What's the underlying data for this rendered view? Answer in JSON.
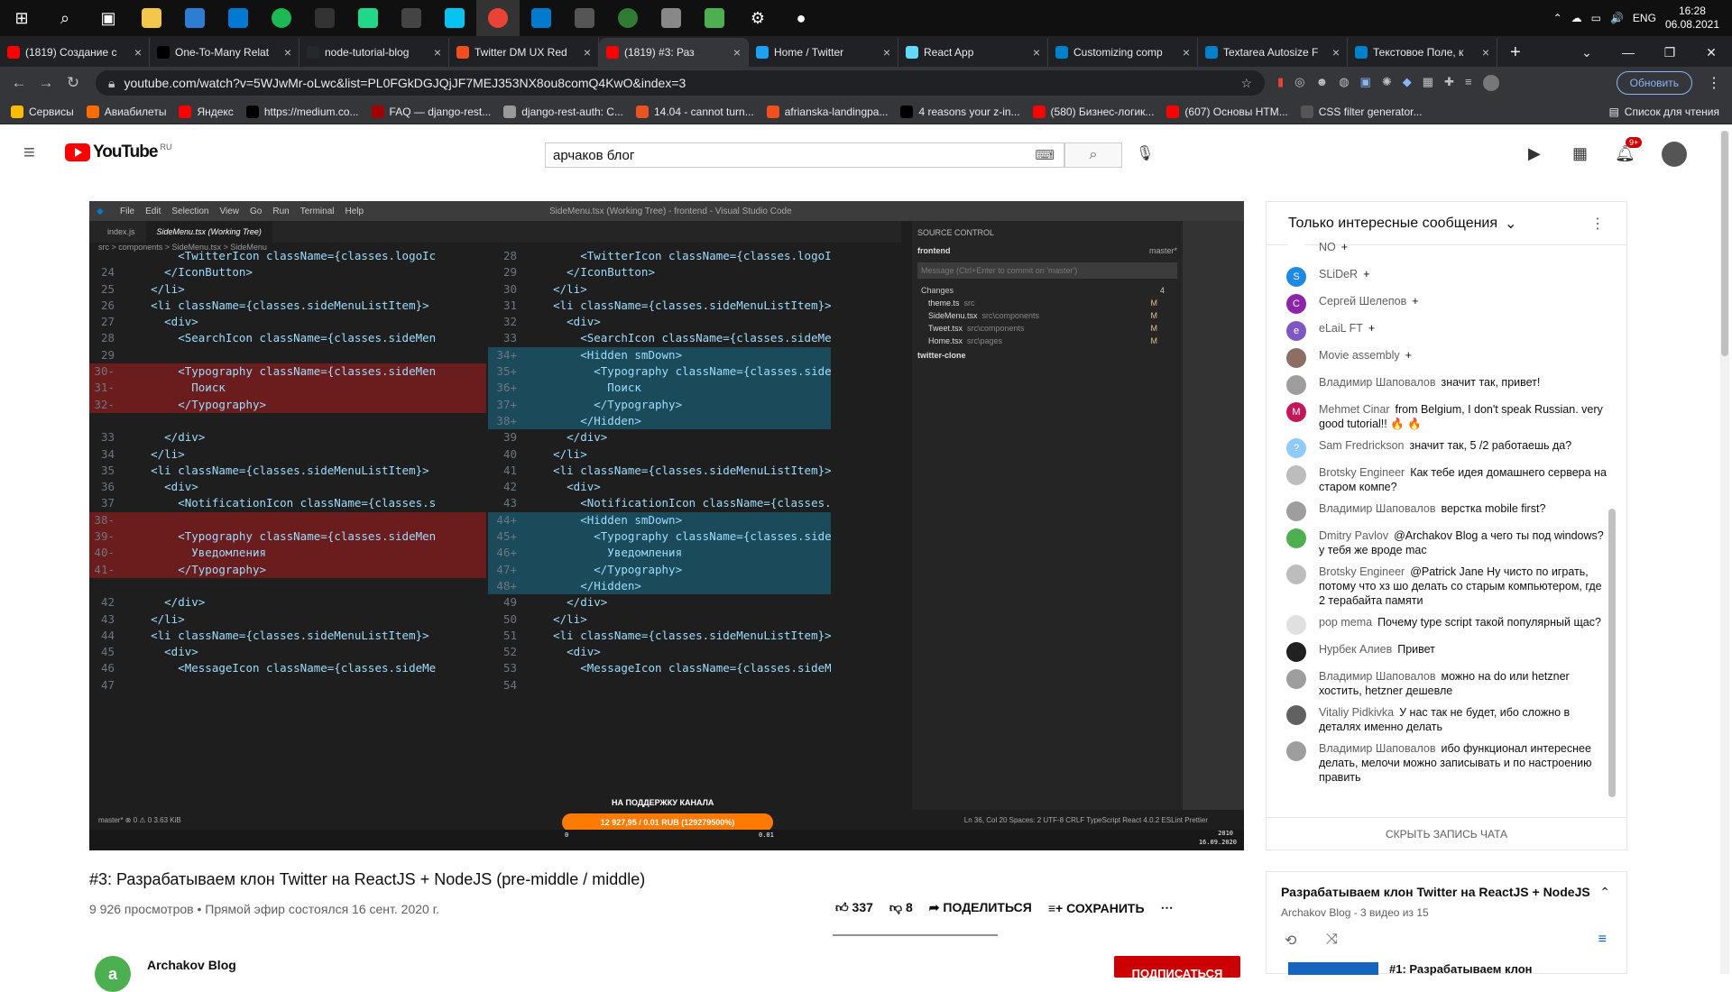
{
  "taskbar": {
    "clock_time": "16:28",
    "clock_date": "06.08.2021",
    "lang": "ENG"
  },
  "tabs": [
    {
      "title": "(1819) Создание с",
      "color": "#ff0000"
    },
    {
      "title": "One-To-Many Relat",
      "color": "#000000"
    },
    {
      "title": "node-tutorial-blog",
      "color": "#24292e"
    },
    {
      "title": "Twitter DM UX Red",
      "color": "#f24e1e"
    },
    {
      "title": "(1819) #3: Раз",
      "color": "#ff0000"
    },
    {
      "title": "Home / Twitter",
      "color": "#1da1f2"
    },
    {
      "title": "React App",
      "color": "#61dafb"
    },
    {
      "title": "Customizing comp",
      "color": "#0081cb"
    },
    {
      "title": "Textarea Autosize F",
      "color": "#0081cb"
    },
    {
      "title": "Текстовое Поле, к",
      "color": "#0081cb"
    }
  ],
  "address": {
    "url": "youtube.com/watch?v=5WJwMr-oLwc&list=PL0FGkDGJQjJF7MEJ353NX8ou8comQ4KwO&index=3",
    "update_label": "Обновить"
  },
  "bookmarks": [
    {
      "label": "Сервисы",
      "color": "#fbbc04"
    },
    {
      "label": "Авиабилеты",
      "color": "#ff6d00"
    },
    {
      "label": "Яндекс",
      "color": "#ff0000"
    },
    {
      "label": "https://medium.co...",
      "color": "#000000"
    },
    {
      "label": "FAQ — django-rest...",
      "color": "#a30000"
    },
    {
      "label": "django-rest-auth: C...",
      "color": "#999999"
    },
    {
      "label": "14.04 - cannot turn...",
      "color": "#e95420"
    },
    {
      "label": "afrianska-landingpa...",
      "color": "#f24e1e"
    },
    {
      "label": "4 reasons your z-in...",
      "color": "#000000"
    },
    {
      "label": "(580) Бизнес-логик...",
      "color": "#ff0000"
    },
    {
      "label": "(607) Основы HTM...",
      "color": "#ff0000"
    },
    {
      "label": "CSS filter generator...",
      "color": "#555555"
    }
  ],
  "bookmarks_reading_list": "Список для чтения",
  "youtube": {
    "logo_text": "YouTube",
    "region": "RU",
    "search_value": "арчаков блог",
    "notif_count": "9+"
  },
  "video_code": {
    "window_title": "SideMenu.tsx (Working Tree) - frontend - Visual Studio Code",
    "menu": [
      "File",
      "Edit",
      "Selection",
      "View",
      "Go",
      "Run",
      "Terminal",
      "Help"
    ],
    "tab1": "index.js",
    "tab2": "SideMenu.tsx (Working Tree)",
    "breadcrumb": "src > components > SideMenu.tsx > SideMenu",
    "left_lines": [
      {
        "n": "",
        "t": "        <TwitterIcon className={classes.logoIc",
        "bg": ""
      },
      {
        "n": "24",
        "t": "      </IconButton>",
        "bg": ""
      },
      {
        "n": "25",
        "t": "    </li>",
        "bg": ""
      },
      {
        "n": "26",
        "t": "    <li className={classes.sideMenuListItem}>",
        "bg": ""
      },
      {
        "n": "27",
        "t": "      <div>",
        "bg": ""
      },
      {
        "n": "28",
        "t": "        <SearchIcon className={classes.sideMen",
        "bg": ""
      },
      {
        "n": "29",
        "t": "",
        "bg": ""
      },
      {
        "n": "30-",
        "t": "        <Typography className={classes.sideMen",
        "bg": "#6b1c1c"
      },
      {
        "n": "31-",
        "t": "          Поиск",
        "bg": "#6b1c1c"
      },
      {
        "n": "32-",
        "t": "        </Typography>",
        "bg": "#6b1c1c"
      },
      {
        "n": "",
        "t": "",
        "bg": ""
      },
      {
        "n": "33",
        "t": "      </div>",
        "bg": ""
      },
      {
        "n": "34",
        "t": "    </li>",
        "bg": ""
      },
      {
        "n": "35",
        "t": "    <li className={classes.sideMenuListItem}>",
        "bg": ""
      },
      {
        "n": "36",
        "t": "      <div>",
        "bg": ""
      },
      {
        "n": "37",
        "t": "        <NotificationIcon className={classes.s",
        "bg": ""
      },
      {
        "n": "38-",
        "t": "",
        "bg": "#6b1c1c"
      },
      {
        "n": "39-",
        "t": "        <Typography className={classes.sideMen",
        "bg": "#6b1c1c"
      },
      {
        "n": "40-",
        "t": "          Уведомления",
        "bg": "#6b1c1c"
      },
      {
        "n": "41-",
        "t": "        </Typography>",
        "bg": "#6b1c1c"
      },
      {
        "n": "",
        "t": "",
        "bg": ""
      },
      {
        "n": "42",
        "t": "      </div>",
        "bg": ""
      },
      {
        "n": "43",
        "t": "    </li>",
        "bg": ""
      },
      {
        "n": "44",
        "t": "    <li className={classes.sideMenuListItem}>",
        "bg": ""
      },
      {
        "n": "45",
        "t": "      <div>",
        "bg": ""
      },
      {
        "n": "46",
        "t": "        <MessageIcon className={classes.sideMe",
        "bg": ""
      },
      {
        "n": "47",
        "t": "",
        "bg": ""
      }
    ],
    "right_lines": [
      {
        "n": "28",
        "t": "        <TwitterIcon className={classes.logoIc",
        "bg": ""
      },
      {
        "n": "29",
        "t": "      </IconButton>",
        "bg": ""
      },
      {
        "n": "30",
        "t": "    </li>",
        "bg": ""
      },
      {
        "n": "31",
        "t": "    <li className={classes.sideMenuListItem}>",
        "bg": ""
      },
      {
        "n": "32",
        "t": "      <div>",
        "bg": ""
      },
      {
        "n": "33",
        "t": "        <SearchIcon className={classes.sideMen",
        "bg": ""
      },
      {
        "n": "34+",
        "t": "        <Hidden smDown>",
        "bg": "#1b4b5a"
      },
      {
        "n": "35+",
        "t": "          <Typography className={classes.sideM",
        "bg": "#1b4b5a"
      },
      {
        "n": "36+",
        "t": "            Поиск",
        "bg": "#1b4b5a"
      },
      {
        "n": "37+",
        "t": "          </Typography>",
        "bg": "#1b4b5a"
      },
      {
        "n": "38+",
        "t": "        </Hidden>",
        "bg": "#1b4b5a"
      },
      {
        "n": "39",
        "t": "      </div>",
        "bg": ""
      },
      {
        "n": "40",
        "t": "    </li>",
        "bg": ""
      },
      {
        "n": "41",
        "t": "    <li className={classes.sideMenuListItem}>",
        "bg": ""
      },
      {
        "n": "42",
        "t": "      <div>",
        "bg": ""
      },
      {
        "n": "43",
        "t": "        <NotificationIcon className={classes.s",
        "bg": ""
      },
      {
        "n": "44+",
        "t": "        <Hidden smDown>",
        "bg": "#1b4b5a"
      },
      {
        "n": "45+",
        "t": "          <Typography className={classes.sideM",
        "bg": "#1b4b5a"
      },
      {
        "n": "46+",
        "t": "            Уведомления",
        "bg": "#1b4b5a"
      },
      {
        "n": "47+",
        "t": "          </Typography>",
        "bg": "#1b4b5a"
      },
      {
        "n": "48+",
        "t": "        </Hidden>",
        "bg": "#1b4b5a"
      },
      {
        "n": "49",
        "t": "      </div>",
        "bg": ""
      },
      {
        "n": "50",
        "t": "    </li>",
        "bg": ""
      },
      {
        "n": "51",
        "t": "    <li className={classes.sideMenuListItem}>",
        "bg": ""
      },
      {
        "n": "52",
        "t": "      <div>",
        "bg": ""
      },
      {
        "n": "53",
        "t": "        <MessageIcon className={classes.sideMe",
        "bg": ""
      },
      {
        "n": "54",
        "t": "",
        "bg": ""
      }
    ],
    "scm": {
      "title": "SOURCE CONTROL",
      "repo1": "frontend",
      "branch": "master*",
      "message_placeholder": "Message (Ctrl+Enter to commit on 'master')",
      "changes_label": "Changes",
      "changes_count": "4",
      "files": [
        {
          "name": "theme.ts",
          "path": "src",
          "status": "M"
        },
        {
          "name": "SideMenu.tsx",
          "path": "src\\components",
          "status": "M"
        },
        {
          "name": "Tweet.tsx",
          "path": "src\\components",
          "status": "M"
        },
        {
          "name": "Home.tsx",
          "path": "src\\pages",
          "status": "M"
        }
      ],
      "repo2": "twitter-clone"
    },
    "status_left": "master*   ⊗ 0 ⚠ 0   3.63 KiB",
    "status_right": "Ln 36, Col 20   Spaces: 2   UTF-8   CRLF   TypeScript React   4.0.2   ESLint   Prettier",
    "donation_title": "НА ПОДДЕРЖКУ КАНАЛА",
    "donation_amount": "12 927,95 / 0.01 RUB (129279500%)",
    "donation_min": "0",
    "donation_max": "0.01",
    "overlay_time": "2010",
    "overlay_date": "16.09.2020"
  },
  "video": {
    "title": "#3: Разрабатываем клон Twitter на ReactJS + NodeJS (pre-middle / middle)",
    "meta": "9 926 просмотров • Прямой эфир состоялся 16 сент. 2020 г.",
    "likes": "337",
    "dislikes": "8",
    "share": "ПОДЕЛИТЬСЯ",
    "save": "СОХРАНИТЬ",
    "channel": "Archakov Blog",
    "subscribe": "ПОДПИСАТЬСЯ"
  },
  "chat": {
    "header": "Только интересные сообщения",
    "hide": "СКРЫТЬ ЗАПИСЬ ЧАТА",
    "messages": [
      {
        "author": "NO",
        "text": "+",
        "avatar_letter": "",
        "avatar_color": "#ffffff"
      },
      {
        "author": "SLiDeR",
        "text": "+",
        "avatar_letter": "S",
        "avatar_color": "#1e88e5"
      },
      {
        "author": "Сергей Шелепов",
        "text": "+",
        "avatar_letter": "С",
        "avatar_color": "#8e24aa"
      },
      {
        "author": "eLaiL FT",
        "text": "+",
        "avatar_letter": "e",
        "avatar_color": "#7e57c2"
      },
      {
        "author": "Movie assembly",
        "text": "+",
        "avatar_letter": "",
        "avatar_color": "#8d6e63"
      },
      {
        "author": "Владимир Шаповалов",
        "text": "значит так, привет!",
        "avatar_letter": "",
        "avatar_color": "#9e9e9e"
      },
      {
        "author": "Mehmet Cinar",
        "text": "from Belgium, I don't speak Russian. very good tutorial!! 🔥 🔥",
        "avatar_letter": "M",
        "avatar_color": "#c2185b"
      },
      {
        "author": "Sam Fredrickson",
        "text": "значит так, 5 /2 работаешь да?",
        "avatar_letter": "?",
        "avatar_color": "#90caf9"
      },
      {
        "author": "Brotsky Engineer",
        "text": "Как тебе идея домашнего сервера на старом компе?",
        "avatar_letter": "",
        "avatar_color": "#bdbdbd"
      },
      {
        "author": "Владимир Шаповалов",
        "text": "верстка mobile first?",
        "avatar_letter": "",
        "avatar_color": "#9e9e9e"
      },
      {
        "author": "Dmitry Pavlov",
        "text": "@Archakov Blog а чего ты под windows? у тебя же вроде mac",
        "avatar_letter": "",
        "avatar_color": "#4caf50"
      },
      {
        "author": "Brotsky Engineer",
        "text": "@Patrick Jane Ну чисто по играть, потому что хз шо делать со старым компьютером, где 2 терабайта памяти",
        "avatar_letter": "",
        "avatar_color": "#bdbdbd"
      },
      {
        "author": "pop mema",
        "text": "Почему type script такой популярный щас?",
        "avatar_letter": "",
        "avatar_color": "#e0e0e0"
      },
      {
        "author": "Нурбек Алиев",
        "text": "Привет",
        "avatar_letter": "",
        "avatar_color": "#212121"
      },
      {
        "author": "Владимир Шаповалов",
        "text": "можно на do или hetzner хостить, hetzner дешевле",
        "avatar_letter": "",
        "avatar_color": "#9e9e9e"
      },
      {
        "author": "Vitaliy Pidkivka",
        "text": "У нас так не будет, ибо сложно в деталях именно делать",
        "avatar_letter": "",
        "avatar_color": "#616161"
      },
      {
        "author": "Владимир Шаповалов",
        "text": "ибо функционал интереснее делать, мелочи можно записывать и по настроению править",
        "avatar_letter": "",
        "avatar_color": "#9e9e9e"
      }
    ]
  },
  "playlist": {
    "title": "Разрабатываем клон Twitter на ReactJS + NodeJS",
    "meta": "Archakov Blog - 3 видео из 15",
    "first_item": "#1: Разрабатываем клон"
  }
}
